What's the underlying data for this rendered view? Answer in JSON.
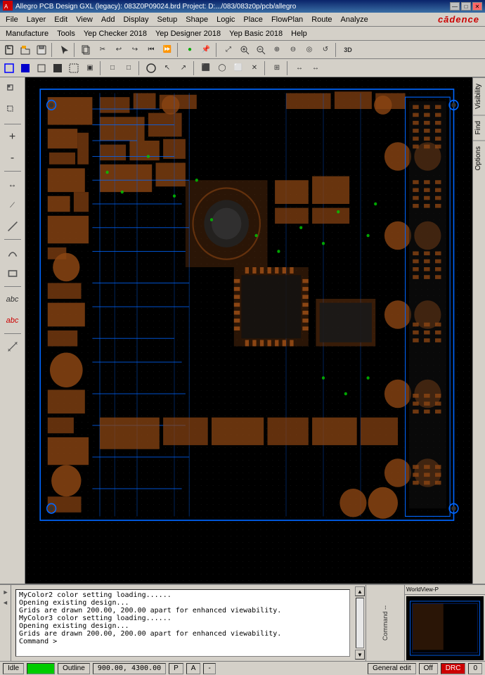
{
  "title_bar": {
    "text": "Allegro PCB Design GXL (legacy): 083Z0P09024.brd  Project: D:.../083/083z0p/pcb/allegro",
    "min_label": "—",
    "max_label": "□",
    "close_label": "✕"
  },
  "menu": {
    "items": [
      "File",
      "Layer",
      "Edit",
      "View",
      "Add",
      "Display",
      "Setup",
      "Shape",
      "Logic",
      "Place",
      "FlowPlan",
      "Route",
      "Analyze"
    ]
  },
  "menu2": {
    "items": [
      "Manufacture",
      "Tools",
      "Yep Checker 2018",
      "Yep Designer 2018",
      "Yep Basic 2018",
      "Help"
    ]
  },
  "cadence": {
    "logo": "cādence"
  },
  "toolbar1": {
    "buttons": [
      "📂",
      "💾",
      "✂",
      "📋",
      "↩",
      "↪",
      "⏮",
      "⏩",
      "🔘",
      "📌",
      "🗑",
      "📄",
      "↩",
      "↪",
      "▼",
      "▶",
      "⊡",
      "⊞",
      "🔍",
      "🔎",
      "⊕",
      "⊖",
      "◎",
      "↺",
      "⤢",
      "3D"
    ]
  },
  "toolbar2": {
    "buttons": [
      "□",
      "■",
      "◻",
      "◼",
      "⬚",
      "▣",
      "□",
      "□",
      "□",
      "◯",
      "↖",
      "↗",
      "↕",
      "⬛",
      "◯",
      "⬜",
      "✕",
      "⊞",
      "↔",
      "↔"
    ]
  },
  "right_panel": {
    "tabs": [
      "Visibility",
      "Find",
      "Options"
    ]
  },
  "command_log": {
    "lines": [
      "MyColor2 color setting loading......",
      "Opening existing design...",
      "Grids are drawn 200.00, 200.00 apart for enhanced viewability.",
      "MyColor3 color setting loading......",
      "Opening existing design...",
      "Grids are drawn 200.00, 200.00 apart for enhanced viewability.",
      "Command >"
    ]
  },
  "status_bar": {
    "state": "Idle",
    "green_indicator": "",
    "outline_label": "Outline",
    "coordinates": "900.00, 4300.00",
    "p_label": "P",
    "a_label": "A",
    "dash": "-",
    "general_edit": "General edit",
    "off_label": "Off",
    "drc_label": "DRC",
    "page_num": "0"
  },
  "left_sidebar": {
    "buttons": [
      "sel",
      "sel2",
      "zoom",
      "zoom2",
      "line",
      "arc",
      "rect",
      "poly",
      "move",
      "copy",
      "del",
      "rot",
      "text",
      "text2",
      "prop",
      "via",
      "layer",
      "net",
      "pad",
      "shape",
      "route",
      "iroute",
      "cline",
      "bus",
      "drc",
      "ant",
      "spread"
    ]
  },
  "worldview": {
    "label": "WorldView-P",
    "bg": "#000000"
  }
}
